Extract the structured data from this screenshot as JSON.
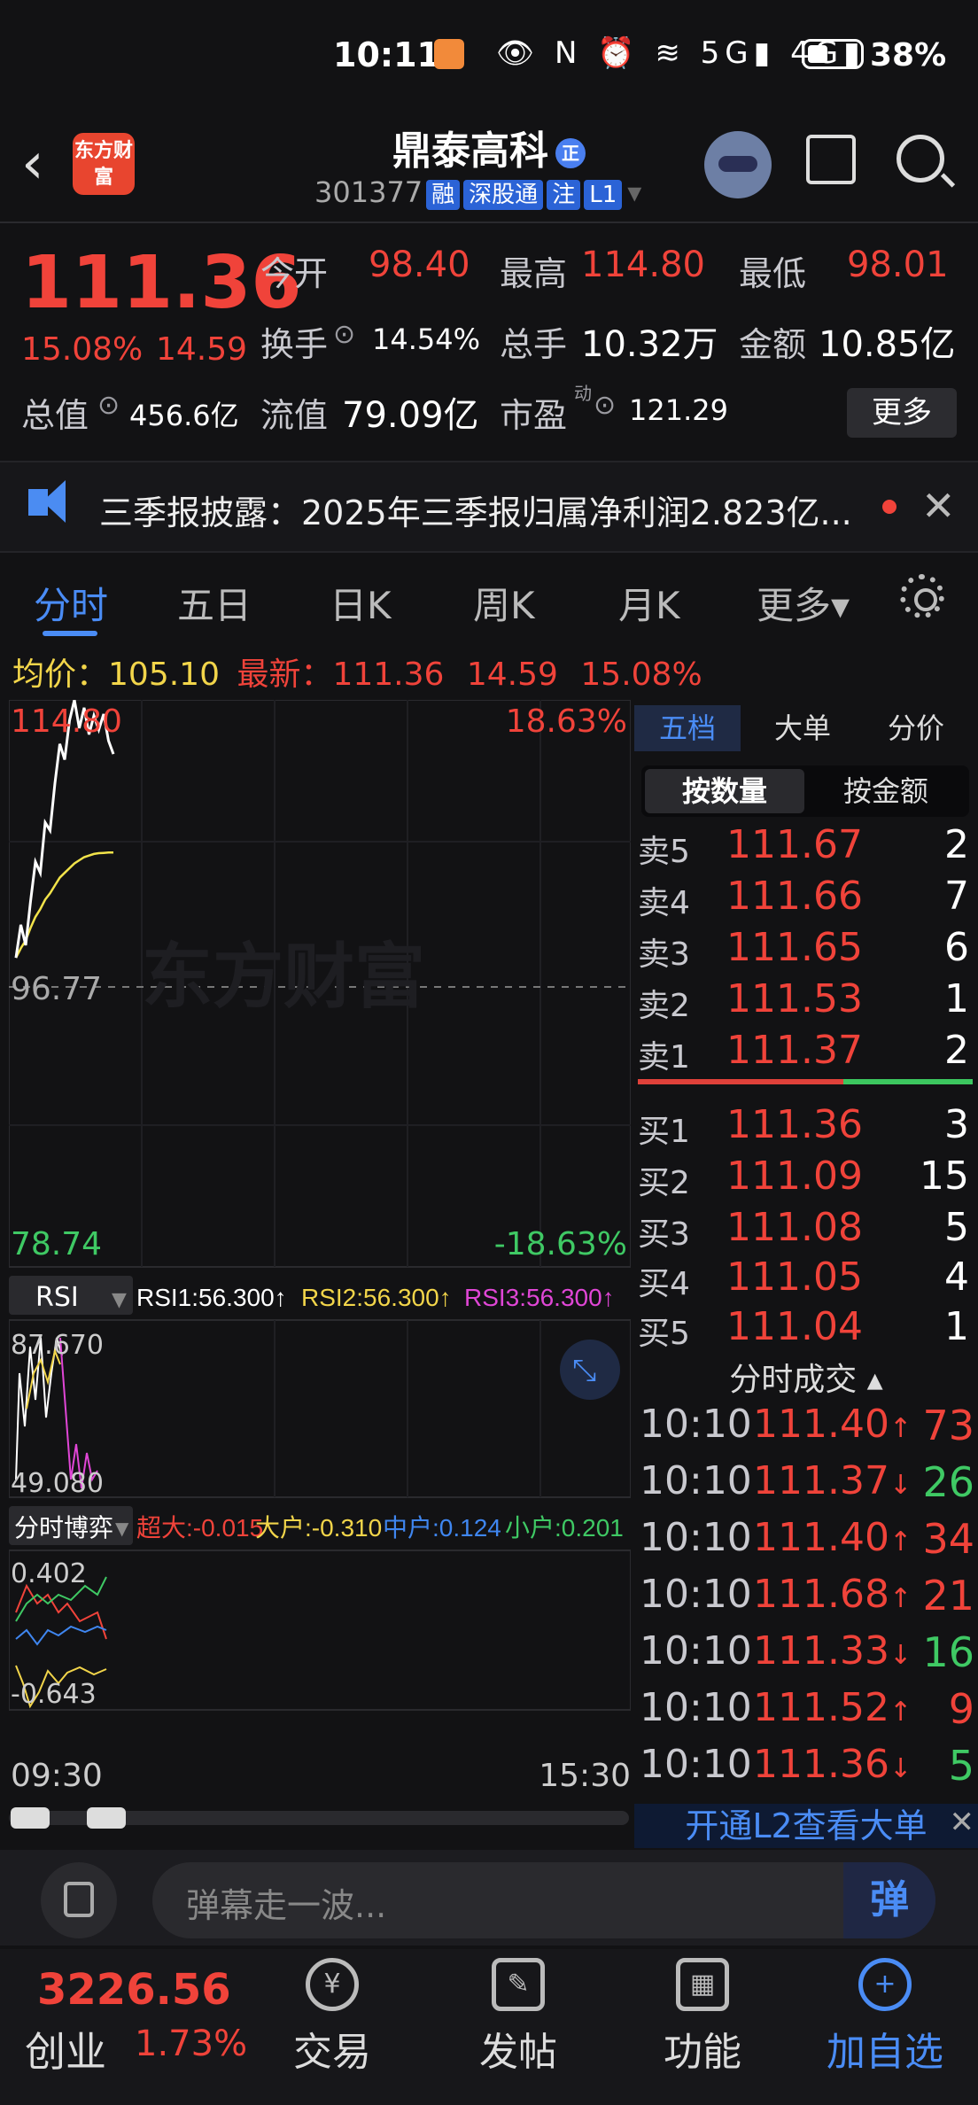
{
  "status": {
    "time": "10:11",
    "icons": "👁 N ⏰ ≋ 5G▮ 4G▮",
    "battery": "38%"
  },
  "header": {
    "logo": "东方财富",
    "name": "鼎泰高科",
    "name_tag": "正",
    "code": "301377",
    "badges": [
      "融",
      "深股通",
      "注",
      "L1"
    ]
  },
  "quote": {
    "price": "111.36",
    "change_pct": "15.08%",
    "change": "14.59",
    "open_label": "今开",
    "open": "98.40",
    "high_label": "最高",
    "high": "114.80",
    "low_label": "最低",
    "low": "98.01",
    "turnover_label": "换手",
    "turnover": "14.54%",
    "volume_label": "总手",
    "volume": "10.32万",
    "amount_label": "金额",
    "amount": "10.85亿",
    "mktcap_label": "总值",
    "mktcap": "456.6亿",
    "float_label": "流值",
    "float": "79.09亿",
    "pe_label": "市盈",
    "pe_sup": "动",
    "pe": "121.29",
    "more": "更多"
  },
  "notice": {
    "text": "三季报披露：2025年三季报归属净利润2.823亿..."
  },
  "tabs": [
    "分时",
    "五日",
    "日K",
    "周K",
    "月K",
    "更多▾"
  ],
  "avgline": {
    "avg_label": "均价：",
    "avg": "105.10",
    "latest_label": "最新：",
    "latest": "111.36",
    "chg": "14.59",
    "pct": "15.08%"
  },
  "chart": {
    "watermark": "东方财富",
    "price_top": "114.80",
    "pct_top": "18.63%",
    "price_mid": "96.77",
    "price_bot": "78.74",
    "pct_bot": "-18.63%",
    "rsi_label": "RSI",
    "rsi1": "RSI1:56.300↑",
    "rsi2": "RSI2:56.300↑",
    "rsi3": "RSI3:56.300↑",
    "rsi_top": "87.670",
    "rsi_bot": "49.080",
    "game_label": "分时博弈",
    "g_super": "超大:-0.015",
    "g_big": "大户:-0.310",
    "g_mid": "中户:0.124",
    "g_small": "小户:0.201",
    "g_top": "0.402",
    "g_bot": "-0.643",
    "time_start": "09:30",
    "time_end": "15:30",
    "colors": {
      "price": "#ffffff",
      "avg": "#f2e34a",
      "rsi1": "#ffffff",
      "rsi2": "#f2d54a",
      "rsi3": "#e046d6"
    }
  },
  "chart_data": {
    "type": "line",
    "x": [
      "09:30",
      "09:32",
      "09:34",
      "09:36",
      "09:38",
      "09:40",
      "09:42",
      "09:44",
      "09:46",
      "09:48",
      "09:50",
      "09:52",
      "09:54",
      "09:56",
      "09:58",
      "10:00",
      "10:02",
      "10:04",
      "10:06",
      "10:08",
      "10:10"
    ],
    "series": [
      {
        "values": [
          98.4,
          100.5,
          99.2,
          102.0,
          104.5,
          103.8,
          107.0,
          106.5,
          109.5,
          112.0,
          111.0,
          113.5,
          114.8,
          113.0,
          114.3,
          112.6,
          113.8,
          112.9,
          113.9,
          112.2,
          111.36
        ]
      },
      {
        "values": [
          98.4,
          99.0,
          99.5,
          100.3,
          101.0,
          101.5,
          102.1,
          102.5,
          103.0,
          103.5,
          103.8,
          104.1,
          104.4,
          104.6,
          104.8,
          104.9,
          105.0,
          105.05,
          105.07,
          105.09,
          105.1
        ]
      }
    ],
    "ylim": [
      78.74,
      114.8
    ]
  },
  "orderbook": {
    "tabs": [
      "五档",
      "大单",
      "分价"
    ],
    "seg": [
      "按数量",
      "按金额"
    ],
    "asks": [
      {
        "label": "卖5",
        "price": "111.67",
        "qty": "2"
      },
      {
        "label": "卖4",
        "price": "111.66",
        "qty": "7"
      },
      {
        "label": "卖3",
        "price": "111.65",
        "qty": "6"
      },
      {
        "label": "卖2",
        "price": "111.53",
        "qty": "1"
      },
      {
        "label": "卖1",
        "price": "111.37",
        "qty": "2"
      }
    ],
    "bids": [
      {
        "label": "买1",
        "price": "111.36",
        "qty": "3"
      },
      {
        "label": "买2",
        "price": "111.09",
        "qty": "15"
      },
      {
        "label": "买3",
        "price": "111.08",
        "qty": "5"
      },
      {
        "label": "买4",
        "price": "111.05",
        "qty": "4"
      },
      {
        "label": "买5",
        "price": "111.04",
        "qty": "1"
      }
    ]
  },
  "trades": {
    "title": "分时成交 ▴",
    "rows": [
      {
        "time": "10:10",
        "price": "111.40",
        "dir": "↑",
        "vol": "73",
        "up": true
      },
      {
        "time": "10:10",
        "price": "111.37",
        "dir": "↓",
        "vol": "26",
        "up": false
      },
      {
        "time": "10:10",
        "price": "111.40",
        "dir": "↑",
        "vol": "34",
        "up": true
      },
      {
        "time": "10:10",
        "price": "111.68",
        "dir": "↑",
        "vol": "21",
        "up": true
      },
      {
        "time": "10:10",
        "price": "111.33",
        "dir": "↓",
        "vol": "16",
        "up": false
      },
      {
        "time": "10:10",
        "price": "111.52",
        "dir": "↑",
        "vol": "9",
        "up": true
      },
      {
        "time": "10:10",
        "price": "111.36",
        "dir": "↓",
        "vol": "5",
        "up": false
      }
    ],
    "l2": "开通L2查看大单"
  },
  "danmaku": {
    "placeholder": "弹幕走一波...",
    "button": "弹"
  },
  "nav": {
    "index_value": "3226.56",
    "index_name": "创业",
    "index_pct": "1.73%",
    "items": [
      {
        "label": "交易",
        "icon": "¥"
      },
      {
        "label": "发帖",
        "icon": "✎"
      },
      {
        "label": "功能",
        "icon": "▦"
      },
      {
        "label": "加自选",
        "icon": "+"
      }
    ]
  }
}
